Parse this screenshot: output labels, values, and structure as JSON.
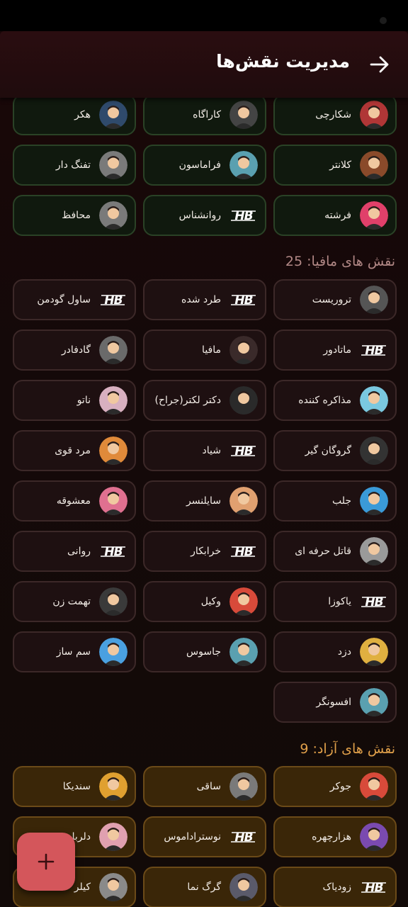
{
  "header": {
    "title": "مدیریت نقش‌ها"
  },
  "citizen_roles": [
    {
      "label": "شکارچی",
      "icon": "hunter-avatar-icon",
      "c": "#b03636"
    },
    {
      "label": "کاراگاه",
      "icon": "detective-avatar-icon",
      "c": "#444444"
    },
    {
      "label": "هکر",
      "icon": "hacker-avatar-icon",
      "c": "#2f4a6b"
    },
    {
      "label": "کلانتر",
      "icon": "sheriff-avatar-icon",
      "c": "#8a4a2a"
    },
    {
      "label": "فراماسون",
      "icon": "freemason-avatar-icon",
      "c": "#5aa0b0"
    },
    {
      "label": "تفنگ دار",
      "icon": "gunman-avatar-icon",
      "c": "#7a7a7a"
    },
    {
      "label": "فرشته",
      "icon": "angel-heart-icon",
      "c": "#e0406a"
    },
    {
      "label": "روانشناس",
      "icon": "hb-logo-icon"
    },
    {
      "label": "محافظ",
      "icon": "guard-avatar-icon",
      "c": "#7a7a7a"
    }
  ],
  "mafia_section": {
    "title": "نقش های مافیا: 25"
  },
  "mafia_roles": [
    {
      "label": "تروریست",
      "icon": "terrorist-avatar-icon",
      "c": "#555555"
    },
    {
      "label": "طرد شده",
      "icon": "hb-logo-icon"
    },
    {
      "label": "ساول گودمن",
      "icon": "hb-logo-icon"
    },
    {
      "label": "ماتادور",
      "icon": "hb-logo-icon"
    },
    {
      "label": "مافیا",
      "icon": "mafia-boss-avatar-icon",
      "c": "#3a2a2a"
    },
    {
      "label": "گادفادر",
      "icon": "godfather-avatar-icon",
      "c": "#6a6a6a"
    },
    {
      "label": "مذاکره کننده",
      "icon": "negotiator-group-icon",
      "c": "#7ac8e0"
    },
    {
      "label": "دکتر لکتر(جراح)",
      "icon": "lecter-mask-icon",
      "c": "#2a2a2a"
    },
    {
      "label": "ناتو",
      "icon": "nato-avatar-icon",
      "c": "#d8b0c0"
    },
    {
      "label": "گروگان گیر",
      "icon": "hostage-taker-icon",
      "c": "#333333"
    },
    {
      "label": "شیاد",
      "icon": "hb-logo-icon"
    },
    {
      "label": "مرد قوی",
      "icon": "strongman-avatar-icon",
      "c": "#e08a3a"
    },
    {
      "label": "جلب",
      "icon": "shield-icon",
      "c": "#3a9ad8"
    },
    {
      "label": "سایلنسر",
      "icon": "silencer-hand-icon",
      "c": "#e0a070"
    },
    {
      "label": "معشوقه",
      "icon": "mistress-avatar-icon",
      "c": "#e07090"
    },
    {
      "label": "قاتل حرفه ای",
      "icon": "assassin-avatar-icon",
      "c": "#9a9a9a"
    },
    {
      "label": "خرابکار",
      "icon": "hb-logo-icon"
    },
    {
      "label": "روانی",
      "icon": "hb-logo-icon"
    },
    {
      "label": "یاکوزا",
      "icon": "hb-logo-icon"
    },
    {
      "label": "وکیل",
      "icon": "lawyer-avatar-icon",
      "c": "#d84a3a"
    },
    {
      "label": "تهمت زن",
      "icon": "slanderer-avatar-icon",
      "c": "#3a3a3a"
    },
    {
      "label": "دزد",
      "icon": "thief-avatar-icon",
      "c": "#e0b040"
    },
    {
      "label": "جاسوس",
      "icon": "spy-avatar-icon",
      "c": "#5aa0b0"
    },
    {
      "label": "سم ساز",
      "icon": "poison-skull-icon",
      "c": "#4aa0e0"
    },
    {
      "label": "افسونگر",
      "icon": "sorcerer-avatar-icon",
      "c": "#5aa0b0"
    }
  ],
  "free_section": {
    "title": "نقش های آزاد: 9"
  },
  "free_roles": [
    {
      "label": "جوکر",
      "icon": "joker-avatar-icon",
      "c": "#d84a3a"
    },
    {
      "label": "ساقی",
      "icon": "dealer-avatar-icon",
      "c": "#7a7a7a"
    },
    {
      "label": "سندیکا",
      "icon": "syndicate-avatar-icon",
      "c": "#e0a030"
    },
    {
      "label": "هزارچهره",
      "icon": "thousand-faces-icon",
      "c": "#7a4ab0"
    },
    {
      "label": "نوستراداموس",
      "icon": "hb-logo-icon"
    },
    {
      "label": "دلربا",
      "icon": "charmer-couple-icon",
      "c": "#e0a0b0"
    },
    {
      "label": "زودیاک",
      "icon": "hb-logo-icon"
    },
    {
      "label": "گرگ نما",
      "icon": "werewolf-avatar-icon",
      "c": "#5a5a6a"
    },
    {
      "label": "کیلر",
      "icon": "killer-avatar-icon",
      "c": "#8a8a8a"
    }
  ],
  "fab": {
    "icon": "plus-icon"
  },
  "colors": {
    "accent": "#d4565b",
    "mafia_title": "#b28886",
    "free_title": "#e0a04a"
  }
}
